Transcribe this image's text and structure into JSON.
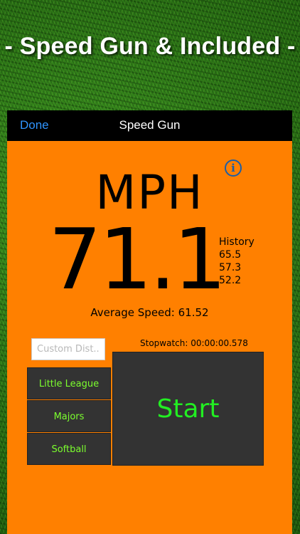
{
  "banner": {
    "text": "- Speed Gun & Included -"
  },
  "navbar": {
    "done_label": "Done",
    "title": "Speed Gun"
  },
  "info": {
    "icon": "info-icon",
    "glyph": "i",
    "color": "#1a5ea8"
  },
  "display": {
    "unit": "MPH",
    "speed": "71.1",
    "history_label": "History",
    "history": [
      "65.5",
      "57.3",
      "52.2"
    ],
    "average": "Average Speed: 61.52"
  },
  "stopwatch": {
    "text": "Stopwatch: 00:00:00.578"
  },
  "distance_input": {
    "placeholder": "Custom Dist...",
    "value": ""
  },
  "modes": [
    "Little League",
    "Majors",
    "Softball"
  ],
  "start_label": "Start",
  "colors": {
    "accent": "#ff8000",
    "button_bg": "#333333",
    "button_text": "#7cff2e",
    "start_text": "#22ee22",
    "nav_link": "#2f95ff"
  }
}
